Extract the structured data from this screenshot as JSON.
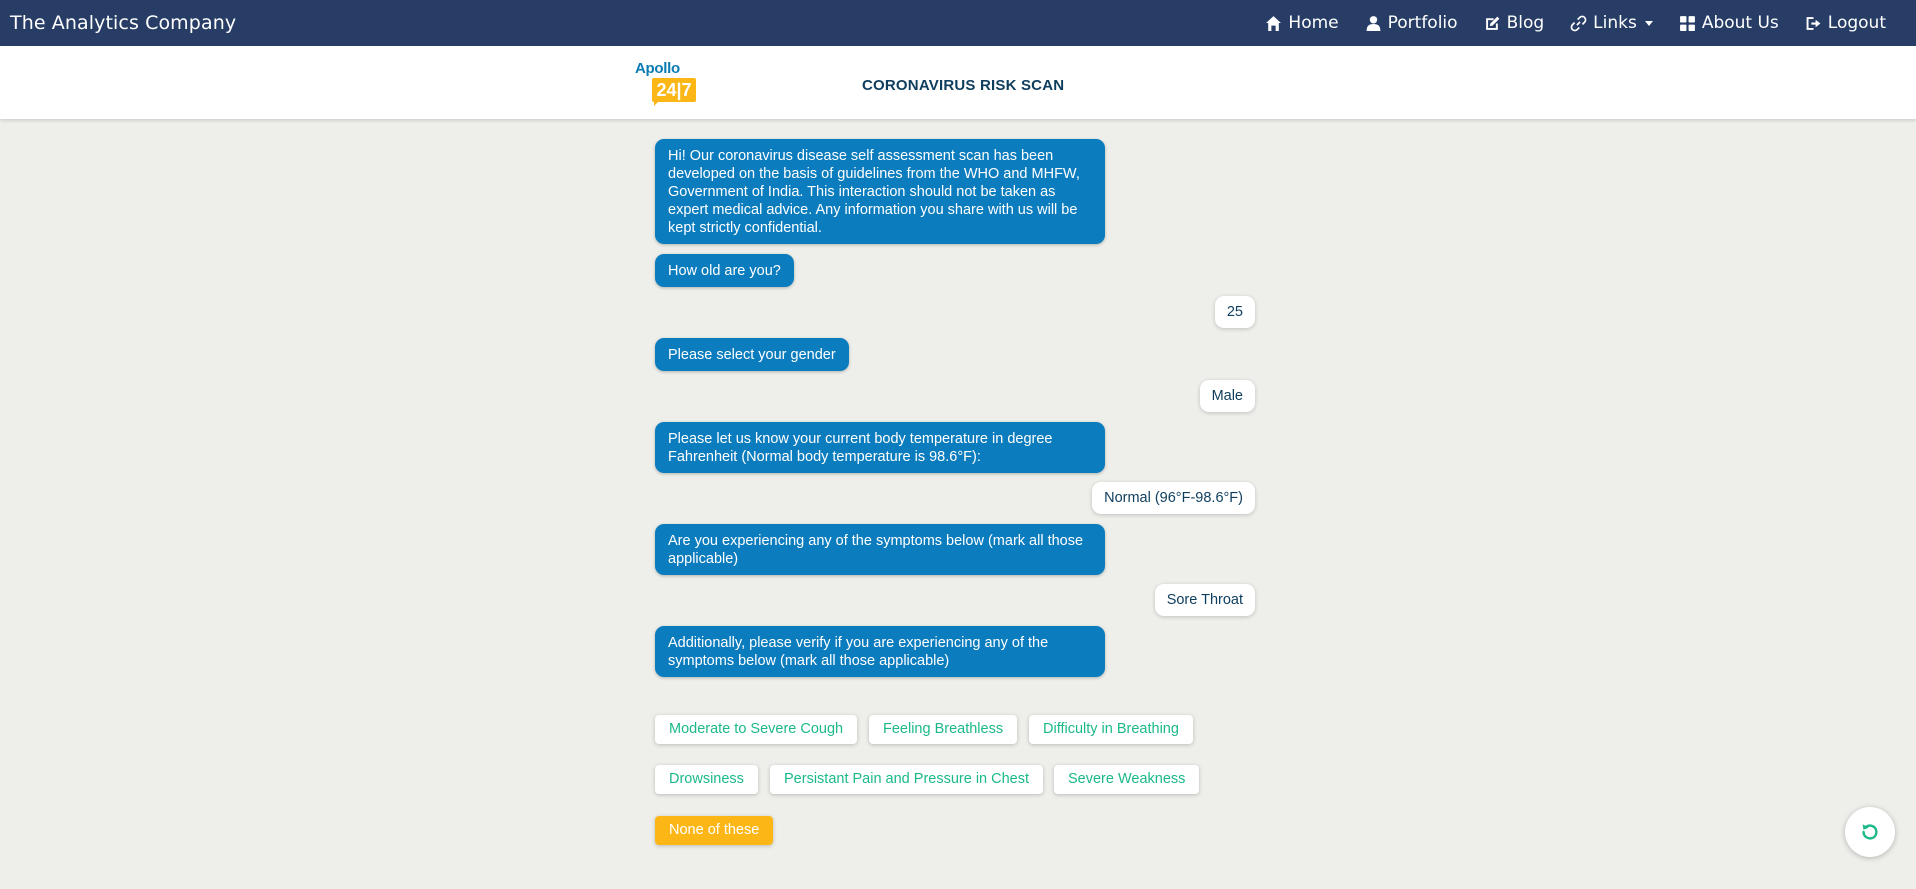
{
  "navbar": {
    "brand": "The Analytics Company",
    "items": [
      {
        "label": "Home",
        "icon": "home-icon"
      },
      {
        "label": "Portfolio",
        "icon": "user-icon"
      },
      {
        "label": "Blog",
        "icon": "edit-icon"
      },
      {
        "label": "Links",
        "icon": "link-icon",
        "dropdown": true
      },
      {
        "label": "About Us",
        "icon": "grid-icon"
      },
      {
        "label": "Logout",
        "icon": "logout-icon"
      }
    ]
  },
  "header": {
    "logo_top": "Apollo",
    "logo_bottom": "24|7",
    "title": "CORONAVIRUS RISK SCAN"
  },
  "chat": {
    "messages": [
      {
        "from": "bot",
        "text": "Hi! Our coronavirus disease self assessment scan has been developed on the basis of guidelines from the WHO and MHFW, Government of India. This interaction should not be taken as expert medical advice. Any information you share with us will be kept strictly confidential."
      },
      {
        "from": "bot",
        "text": "How old are you?"
      },
      {
        "from": "user",
        "text": "25"
      },
      {
        "from": "bot",
        "text": "Please select your gender"
      },
      {
        "from": "user",
        "text": "Male"
      },
      {
        "from": "bot",
        "text": "Please let us know your current body temperature in degree Fahrenheit (Normal body temperature is 98.6°F):"
      },
      {
        "from": "user",
        "text": "Normal (96°F-98.6°F)"
      },
      {
        "from": "bot",
        "text": "Are you experiencing any of the symptoms below (mark all those applicable)"
      },
      {
        "from": "user",
        "text": "Sore Throat"
      },
      {
        "from": "bot",
        "text": "Additionally, please verify if you are experiencing any of the symptoms below (mark all those applicable)"
      }
    ],
    "options": [
      "Moderate to Severe Cough",
      "Feeling Breathless",
      "Difficulty in Breathing",
      "Drowsiness",
      "Persistant Pain and Pressure in Chest",
      "Severe Weakness",
      "None of these"
    ]
  },
  "colors": {
    "navbar": "#273d65",
    "bot_bubble": "#0b7cbd",
    "option_text": "#1bb98a",
    "none_option": "#fcb716",
    "background": "#eeefea"
  }
}
